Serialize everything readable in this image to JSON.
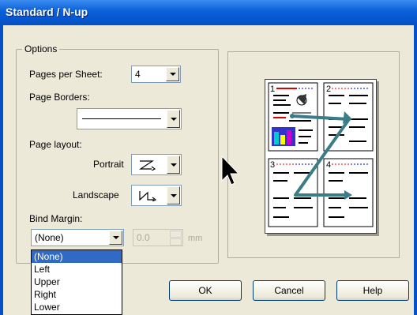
{
  "window": {
    "title": "Standard / N-up"
  },
  "options": {
    "group_label": "Options",
    "pages_per_sheet_label": "Pages per Sheet:",
    "pages_per_sheet_value": "4",
    "page_borders_label": "Page Borders:",
    "page_layout_label": "Page layout:",
    "portrait_label": "Portrait",
    "landscape_label": "Landscape",
    "bind_margin_label": "Bind Margin:",
    "bind_margin_value": "(None)",
    "bind_margin_options": [
      "(None)",
      "Left",
      "Upper",
      "Right",
      "Lower"
    ],
    "margin_amount": "0.0",
    "margin_unit": "mm"
  },
  "preview": {
    "page_numbers": [
      "1",
      "2",
      "3",
      "4"
    ]
  },
  "buttons": {
    "ok": "OK",
    "cancel": "Cancel",
    "help": "Help"
  },
  "colors": {
    "title_bar": "#0451c6",
    "selection": "#316ac5",
    "arrow": "#3a7d86"
  }
}
